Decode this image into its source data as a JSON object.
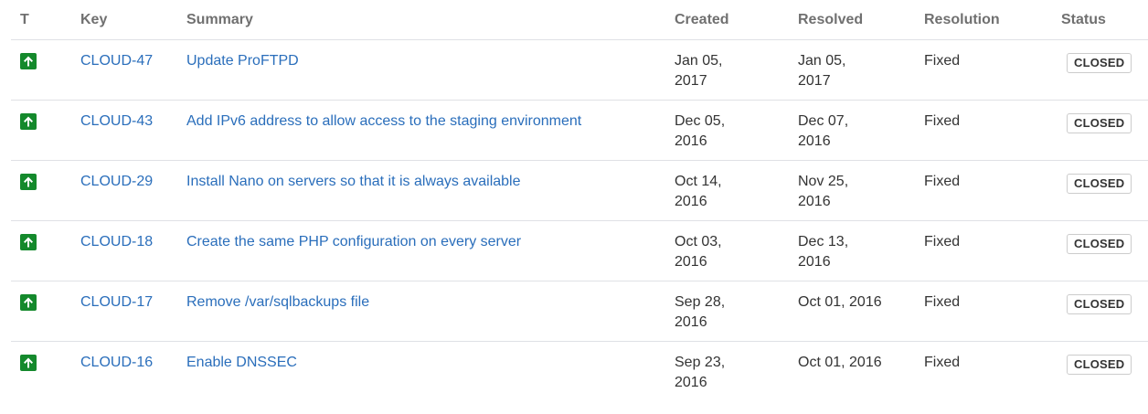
{
  "columns": {
    "type": "T",
    "key": "Key",
    "summary": "Summary",
    "created": "Created",
    "resolved": "Resolved",
    "resolution": "Resolution",
    "status": "Status"
  },
  "colors": {
    "type_icon_bg": "#14892c",
    "link": "#2a6ebb"
  },
  "type_icon": "arrow-up-icon",
  "issues": [
    {
      "key": "CLOUD-47",
      "summary": "Update ProFTPD",
      "created_line1": "Jan 05,",
      "created_line2": "2017",
      "resolved_line1": "Jan 05,",
      "resolved_line2": "2017",
      "resolution": "Fixed",
      "status": "CLOSED"
    },
    {
      "key": "CLOUD-43",
      "summary": "Add IPv6 address to allow access to the staging environment",
      "created_line1": "Dec 05,",
      "created_line2": "2016",
      "resolved_line1": "Dec 07,",
      "resolved_line2": "2016",
      "resolution": "Fixed",
      "status": "CLOSED"
    },
    {
      "key": "CLOUD-29",
      "summary": "Install Nano on servers so that it is always available",
      "created_line1": "Oct 14,",
      "created_line2": "2016",
      "resolved_line1": "Nov 25,",
      "resolved_line2": "2016",
      "resolution": "Fixed",
      "status": "CLOSED"
    },
    {
      "key": "CLOUD-18",
      "summary": "Create the same PHP configuration on every server",
      "created_line1": "Oct 03,",
      "created_line2": "2016",
      "resolved_line1": "Dec 13,",
      "resolved_line2": "2016",
      "resolution": "Fixed",
      "status": "CLOSED"
    },
    {
      "key": "CLOUD-17",
      "summary": "Remove /var/sqlbackups file",
      "created_line1": "Sep 28,",
      "created_line2": "2016",
      "resolved_line1": "Oct 01, 2016",
      "resolved_line2": "",
      "resolution": "Fixed",
      "status": "CLOSED"
    },
    {
      "key": "CLOUD-16",
      "summary": "Enable DNSSEC",
      "created_line1": "Sep 23,",
      "created_line2": "2016",
      "resolved_line1": "Oct 01, 2016",
      "resolved_line2": "",
      "resolution": "Fixed",
      "status": "CLOSED"
    }
  ]
}
